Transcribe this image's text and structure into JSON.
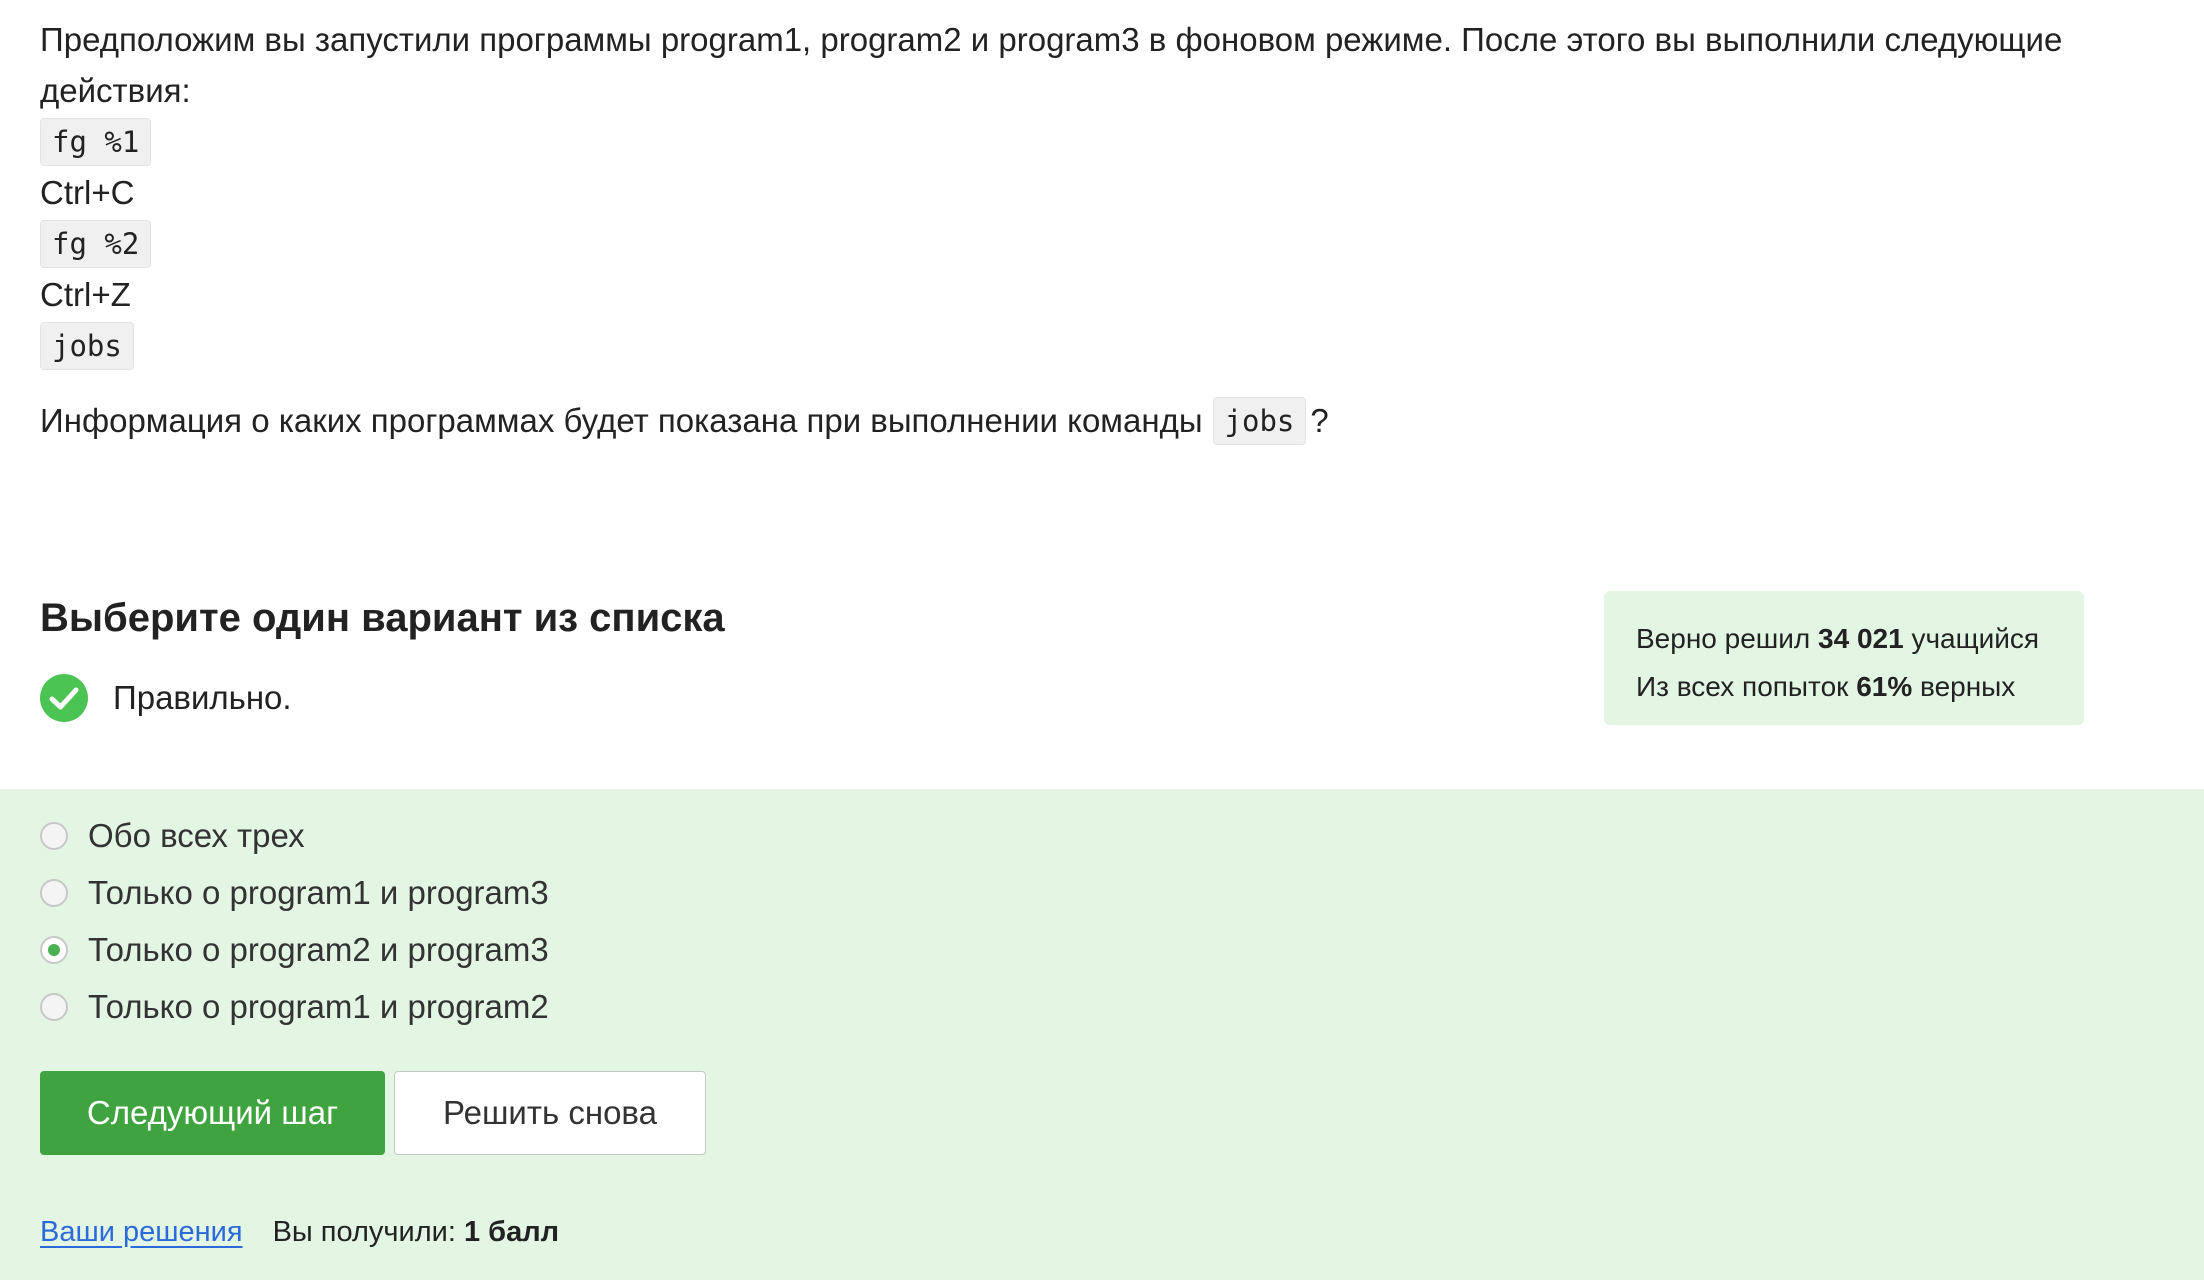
{
  "question": {
    "intro": "Предположим вы запустили программы program1, program2 и program3 в фоновом режиме. После этого вы выполнили следующие действия:",
    "commands": [
      {
        "text": "fg %1",
        "is_code": true
      },
      {
        "text": "Ctrl+C",
        "is_code": false
      },
      {
        "text": "fg %2",
        "is_code": true
      },
      {
        "text": "Ctrl+Z",
        "is_code": false
      },
      {
        "text": "jobs",
        "is_code": true
      }
    ],
    "prompt_before": "Информация о каких программах будет показана при выполнении команды",
    "prompt_code": "jobs",
    "prompt_after": "?"
  },
  "choose_title": "Выберите один вариант из списка",
  "result": {
    "text": "Правильно.",
    "icon": "check-circle-icon",
    "color": "#4cc454"
  },
  "stats": {
    "line1_prefix": "Верно решил",
    "line1_value": "34 021",
    "line1_suffix": "учащийся",
    "line2_prefix": "Из всех попыток",
    "line2_value": "61%",
    "line2_suffix": "верных"
  },
  "options": [
    {
      "label": "Обо всех трех",
      "selected": false
    },
    {
      "label": "Только о program1 и program3",
      "selected": false
    },
    {
      "label": "Только о program2 и program3",
      "selected": true
    },
    {
      "label": "Только о program1 и program2",
      "selected": false
    }
  ],
  "buttons": {
    "next": "Следующий шаг",
    "retry": "Решить снова"
  },
  "footer": {
    "solutions_link": "Ваши решения",
    "score_prefix": "Вы получили:",
    "score_value": "1 балл"
  },
  "colors": {
    "accent_green": "#3fa33f",
    "panel_bg": "#e3f6e3",
    "link": "#2b6ad8"
  }
}
